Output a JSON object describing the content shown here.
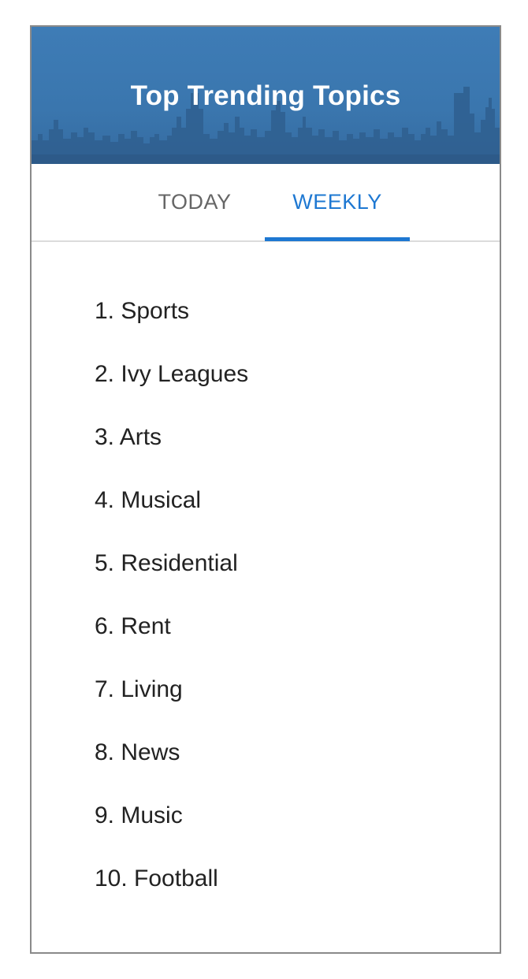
{
  "header": {
    "title": "Top Trending Topics",
    "background_color": "#3a76ae"
  },
  "tabs": [
    {
      "label": "TODAY",
      "active": false,
      "color": "#666666"
    },
    {
      "label": "WEEKLY",
      "active": true,
      "color": "#1e78d2"
    }
  ],
  "topics": [
    "1. Sports",
    "2. Ivy Leagues",
    "3. Arts",
    "4. Musical",
    "5. Residential",
    "6. Rent",
    "7. Living",
    "8. News",
    "9. Music",
    "10. Football"
  ]
}
